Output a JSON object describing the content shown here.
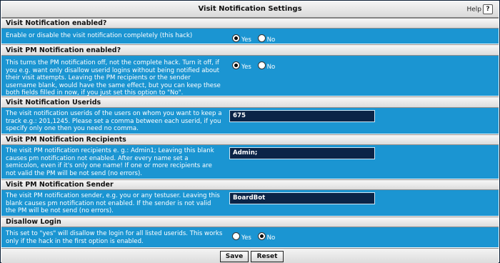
{
  "header": {
    "title": "Visit Notification Settings",
    "help_label": "Help",
    "help_icon": "?"
  },
  "sections": [
    {
      "heading": "Visit Notification enabled?",
      "description": "Enable or disable the visit notification completely (this hack)",
      "control": "radio",
      "options": [
        "Yes",
        "No"
      ],
      "selected": "Yes"
    },
    {
      "heading": "Visit PM Notification enabled?",
      "description": "This turns the PM notification off, not the complete hack. Turn it off, if you e.g. want only disallow userid logins without being notified about their visit attempts. Leaving the PM recipients or the sender username blank, would have the same effect, but you can keep these both fields filled in now, if you just set this option to \"No\".",
      "control": "radio",
      "options": [
        "Yes",
        "No"
      ],
      "selected": "Yes"
    },
    {
      "heading": "Visit Notification Userids",
      "description": "The visit notification userids of the users on whom you want to keep a track e.g.: 201,1245. Please set a comma between each userid, if you specify only one then you need no comma.",
      "control": "text",
      "value": "675"
    },
    {
      "heading": "Visit PM Notification Recipients",
      "description": "The visit PM notification recipients e. g.: Admin1; Leaving this blank causes pm notification not enabled. After every name set a semicolon, even if it's only one name! If one or more recipients are not valid the PM will be not send (no errors).",
      "control": "text",
      "value": "Admin;"
    },
    {
      "heading": "Visit PM Notification Sender",
      "description": "The visit PM notification sender, e.g. you or any testuser. Leaving this blank causes pm notification not enabled. If the sender is not valid the PM will be not send (no errors).",
      "control": "text",
      "value": "BoardBot"
    },
    {
      "heading": "Disallow Login",
      "description": "This set to \"yes\" will disallow the login for all listed userids. This works only if the hack in the first option is enabled.",
      "control": "radio",
      "options": [
        "Yes",
        "No"
      ],
      "selected": "No"
    }
  ],
  "footer": {
    "save_label": "Save",
    "reset_label": "Reset"
  },
  "colors": {
    "section_body": "#1b95d2",
    "input_bg": "#0b2447"
  }
}
